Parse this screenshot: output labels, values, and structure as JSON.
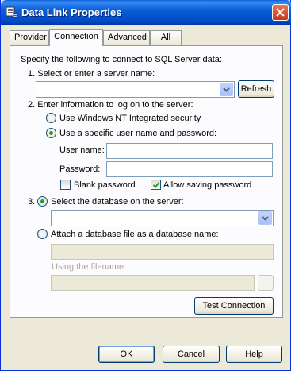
{
  "window": {
    "title": "Data Link Properties"
  },
  "tabs": [
    {
      "label": "Provider",
      "active": false
    },
    {
      "label": "Connection",
      "active": true
    },
    {
      "label": "Advanced",
      "active": false
    },
    {
      "label": "All",
      "active": false
    }
  ],
  "connection": {
    "intro": "Specify the following to connect to SQL Server data:",
    "step1_label": "1. Select or enter a server name:",
    "server_value": "",
    "refresh_label": "Refresh",
    "step2_label": "2. Enter information to log on to the server:",
    "windows_nt_label": "Use Windows NT Integrated security",
    "specific_user_label": "Use a specific user name and password:",
    "username_label": "User name:",
    "username_value": "",
    "password_label": "Password:",
    "password_value": "",
    "blank_password_label": "Blank password",
    "blank_password_checked": false,
    "allow_saving_label": "Allow saving password",
    "allow_saving_checked": true,
    "step3_number": "3.",
    "select_db_label": "Select the database on the server:",
    "database_value": "",
    "attach_db_label": "Attach a database file as a database name:",
    "attach_name_value": "",
    "filename_label": "Using the filename:",
    "filename_value": "",
    "browse_label": "...",
    "test_label": "Test Connection"
  },
  "footer": {
    "ok_label": "OK",
    "cancel_label": "Cancel",
    "help_label": "Help"
  },
  "colors": {
    "titlebar": "#0a5fd8",
    "tab_highlight": "#e68b2c",
    "radio_dot": "#21a121",
    "check_mark": "#21a121"
  }
}
